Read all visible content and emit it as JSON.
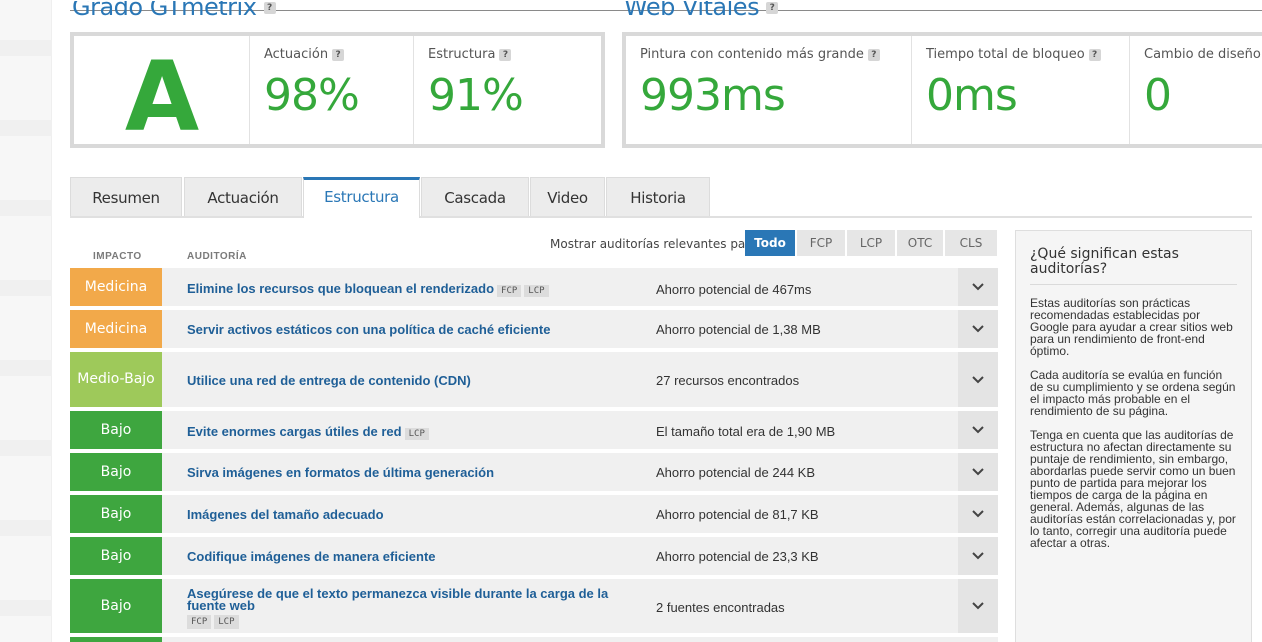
{
  "sections": {
    "grade_title": "Grado GTmetrix",
    "vitals_title": "Web Vitales"
  },
  "grade": {
    "letter": "A",
    "performance_label": "Actuación",
    "performance_value": "98%",
    "structure_label": "Estructura",
    "structure_value": "91%"
  },
  "vitals": {
    "lcp_label": "Pintura con contenido más grande",
    "lcp_value": "993ms",
    "tbt_label": "Tiempo total de bloqueo",
    "tbt_value": "0ms",
    "cls_label": "Cambio de diseño",
    "cls_value": "0"
  },
  "tabs": [
    {
      "label": "Resumen"
    },
    {
      "label": "Actuación"
    },
    {
      "label": "Estructura"
    },
    {
      "label": "Cascada"
    },
    {
      "label": "Video"
    },
    {
      "label": "Historia"
    }
  ],
  "audits": {
    "col_impact": "IMPACTO",
    "col_audit": "AUDITORÍA",
    "filter_label": "Mostrar auditorías relevantes para",
    "filters": [
      "Todo",
      "FCP",
      "LCP",
      "OTC",
      "CLS"
    ],
    "rows": [
      {
        "impact": "Medicina",
        "title": "Elimine los recursos que bloquean el renderizado",
        "tags": [
          "FCP",
          "LCP"
        ],
        "savings": "Ahorro potencial de 467ms"
      },
      {
        "impact": "Medicina",
        "title": "Servir activos estáticos con una política de caché eficiente",
        "tags": [],
        "savings": "Ahorro potencial de 1,38 MB"
      },
      {
        "impact": "Medio-Bajo",
        "title": "Utilice una red de entrega de contenido (CDN)",
        "tags": [],
        "savings": "27 recursos encontrados"
      },
      {
        "impact": "Bajo",
        "title": "Evite enormes cargas útiles de red",
        "tags": [
          "LCP"
        ],
        "savings": "El tamaño total era de 1,90 MB"
      },
      {
        "impact": "Bajo",
        "title": "Sirva imágenes en formatos de última generación",
        "tags": [],
        "savings": "Ahorro potencial de 244 KB"
      },
      {
        "impact": "Bajo",
        "title": "Imágenes del tamaño adecuado",
        "tags": [],
        "savings": "Ahorro potencial de 81,7 KB"
      },
      {
        "impact": "Bajo",
        "title": "Codifique imágenes de manera eficiente",
        "tags": [],
        "savings": "Ahorro potencial de 23,3 KB"
      },
      {
        "impact": "Bajo",
        "title": "Asegúrese de que el texto permanezca visible durante la carga de la fuente web",
        "tags": [
          "FCP",
          "LCP"
        ],
        "savings": "2 fuentes encontradas"
      }
    ]
  },
  "sidebar": {
    "title": "¿Qué significan estas auditorías?",
    "p1": "Estas auditorías son prácticas recomendadas establecidas por Google para ayudar a crear sitios web para un rendimiento de front-end óptimo.",
    "p2": "Cada auditoría se evalúa en función de su cumplimiento y se ordena según el impacto más probable en el rendimiento de su página.",
    "p3": "Tenga en cuenta que las auditorías de estructura no afectan directamente su puntaje de rendimiento, sin embargo, abordarlas puede servir como un buen punto de partida para mejorar los tiempos de carga de la página en general. Además, algunas de las auditorías están correlacionadas y, por lo tanto, corregir una auditoría puede afectar a otras."
  },
  "colors": {
    "accent": "#2a77b6",
    "score_green": "#35a83b",
    "impact_medium": "#f2a94a",
    "impact_medium_low": "#9ec95a",
    "impact_low": "#3ea63f"
  }
}
